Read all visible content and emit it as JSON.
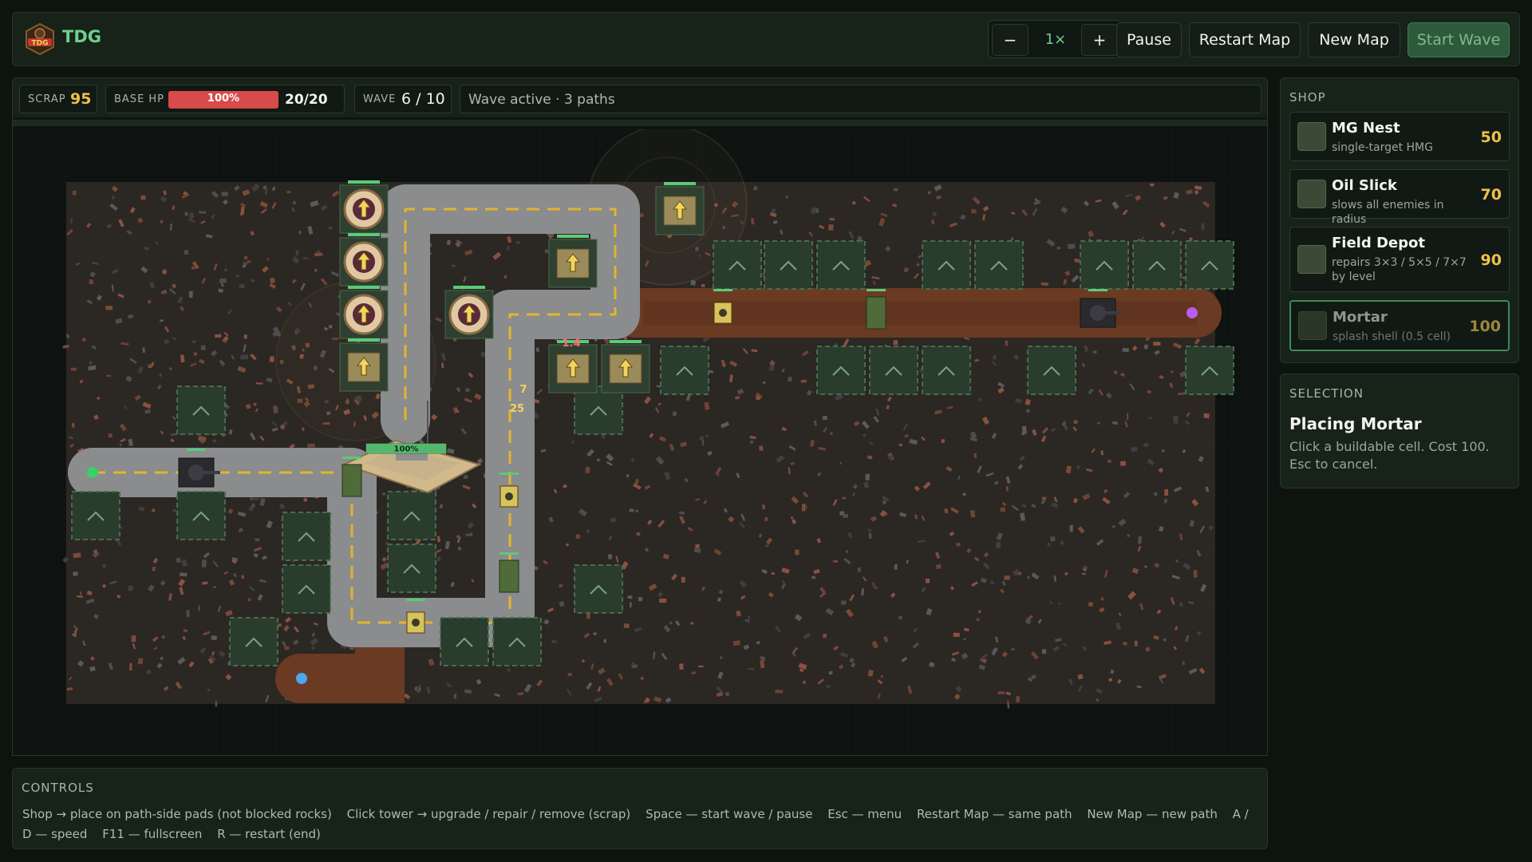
{
  "header": {
    "brand": "TDG",
    "logo_text": "TDG",
    "speed_minus": "−",
    "speed_value": "1×",
    "speed_plus": "+",
    "pause_label": "Pause",
    "restart_label": "Restart Map",
    "new_map_label": "New Map",
    "start_wave_label": "Start Wave"
  },
  "stats": {
    "scrap_label": "SCRAP",
    "scrap_value": "95",
    "base_hp_label": "BASE HP",
    "base_hp_percent": "100%",
    "base_hp_fraction": 1.0,
    "base_hp_value": "20/20",
    "wave_label": "WAVE",
    "wave_value": "6 / 10",
    "status_text": "Wave active · 3 paths"
  },
  "board": {
    "base_hp_label": "100%",
    "damage_label": "1.4",
    "float_number_1": "7",
    "float_number_2": "25"
  },
  "shop": {
    "title": "SHOP",
    "items": [
      {
        "name": "MG Nest",
        "desc": "single-target HMG",
        "price": "50"
      },
      {
        "name": "Oil Slick",
        "desc": "slows all enemies in radius",
        "price": "70"
      },
      {
        "name": "Field Depot",
        "desc": "repairs 3×3 / 5×5 / 7×7 by level",
        "price": "90"
      },
      {
        "name": "Mortar",
        "desc": "splash shell (0.5 cell)",
        "price": "100"
      }
    ]
  },
  "selection": {
    "title": "SELECTION",
    "heading": "Placing Mortar",
    "text": "Click a buildable cell. Cost 100. Esc to cancel."
  },
  "controls": {
    "title": "CONTROLS",
    "items": [
      "Shop → place on path-side pads (not blocked rocks)",
      "Click tower → upgrade / repair / remove (scrap)",
      "Space — start wave / pause",
      "Esc — menu",
      "Restart Map — same path",
      "New Map — new path",
      "A / D — speed",
      "F11 — fullscreen",
      "R — restart (end)"
    ]
  },
  "colors": {
    "accent_green": "#6fd08c",
    "price_gold": "#f0c04a",
    "hp_red": "#d94a4a",
    "path_gray": "#8a8c8e",
    "dirt_path": "#6b3a22",
    "path_dash": "#e3b52e"
  }
}
